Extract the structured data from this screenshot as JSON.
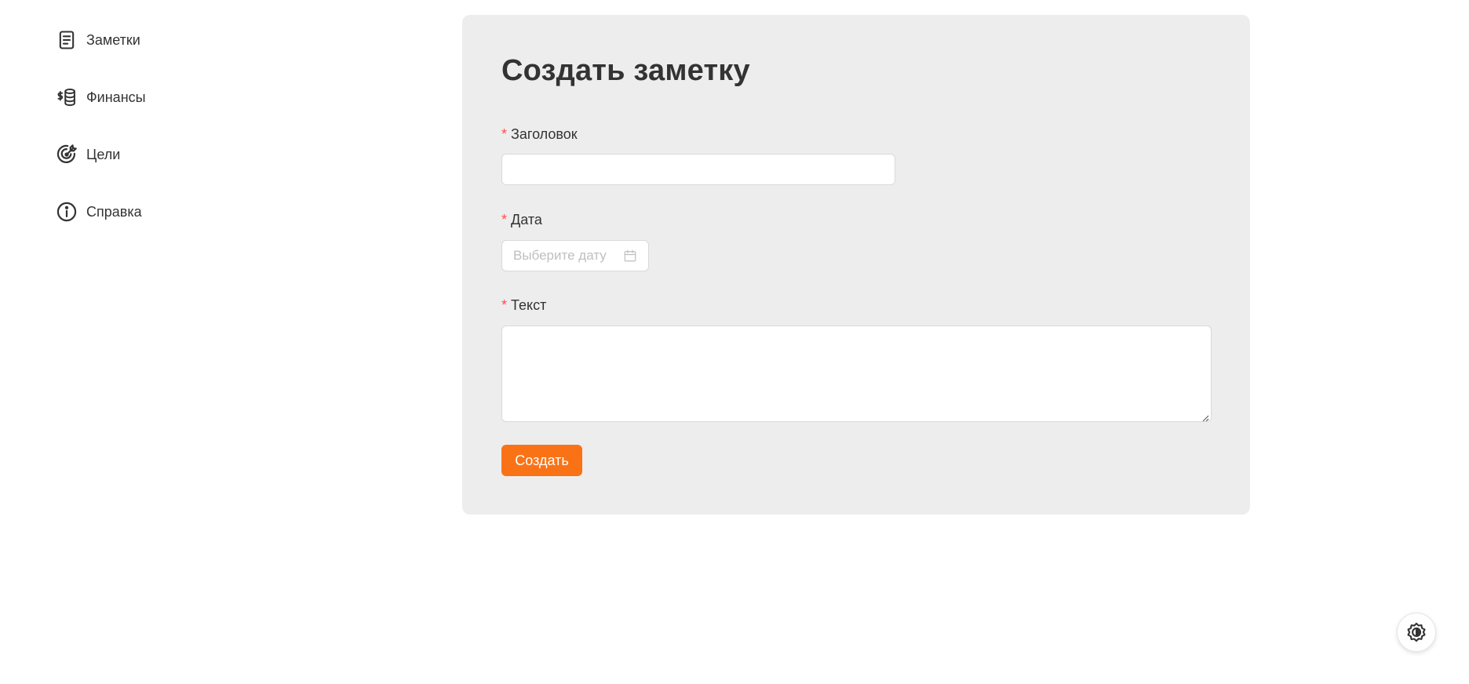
{
  "sidebar": {
    "items": [
      {
        "label": "Заметки",
        "icon": "notes-icon"
      },
      {
        "label": "Финансы",
        "icon": "finance-icon"
      },
      {
        "label": "Цели",
        "icon": "target-icon"
      },
      {
        "label": "Справка",
        "icon": "info-icon"
      }
    ]
  },
  "form": {
    "title": "Создать заметку",
    "required_mark": "*",
    "fields": {
      "title": {
        "label": "Заголовок",
        "value": ""
      },
      "date": {
        "label": "Дата",
        "placeholder": "Выберите дату",
        "icon": "calendar-icon"
      },
      "text": {
        "label": "Текст",
        "value": ""
      }
    },
    "submit_label": "Создать"
  },
  "colors": {
    "accent": "#f97316",
    "required": "#ff4d4f",
    "card_bg": "#ededed"
  },
  "theme_toggle": {
    "icon": "theme-toggle-icon"
  }
}
